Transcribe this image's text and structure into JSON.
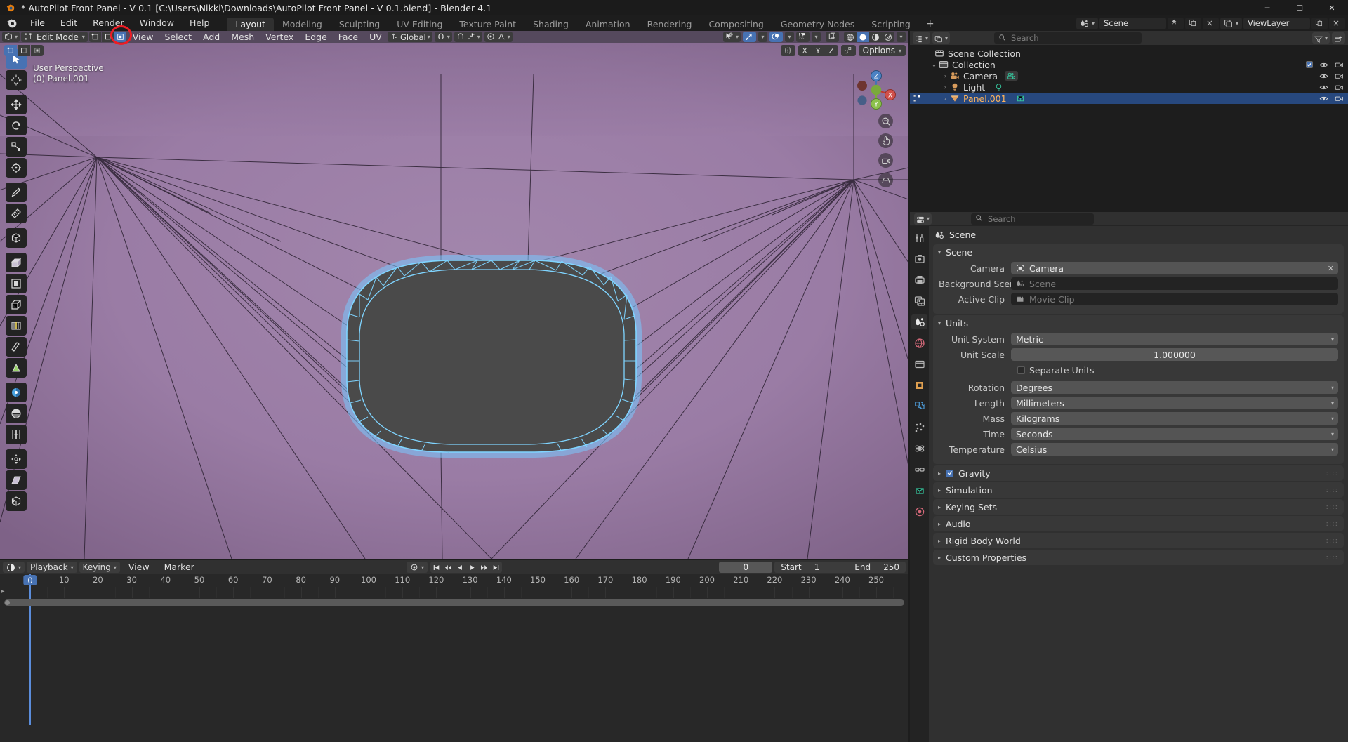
{
  "window": {
    "title": "* AutoPilot Front Panel - V 0.1 [C:\\Users\\Nikki\\Downloads\\AutoPilot Front Panel - V 0.1.blend] - Blender 4.1",
    "minimize": "─",
    "maximize": "☐",
    "close": "✕"
  },
  "topbar": {
    "menus": [
      "File",
      "Edit",
      "Render",
      "Window",
      "Help"
    ],
    "workspaces": [
      {
        "label": "Layout",
        "active": true
      },
      {
        "label": "Modeling",
        "active": false
      },
      {
        "label": "Sculpting",
        "active": false
      },
      {
        "label": "UV Editing",
        "active": false
      },
      {
        "label": "Texture Paint",
        "active": false
      },
      {
        "label": "Shading",
        "active": false
      },
      {
        "label": "Animation",
        "active": false
      },
      {
        "label": "Rendering",
        "active": false
      },
      {
        "label": "Compositing",
        "active": false
      },
      {
        "label": "Geometry Nodes",
        "active": false
      },
      {
        "label": "Scripting",
        "active": false
      }
    ],
    "add_workspace": "+",
    "scene_name": "Scene",
    "viewlayer_name": "ViewLayer"
  },
  "viewport": {
    "mode": "Edit Mode",
    "menus": [
      "View",
      "Select",
      "Add",
      "Mesh",
      "Vertex",
      "Edge",
      "Face",
      "UV"
    ],
    "transform_orientation": "Global",
    "options_label": "Options",
    "proportional_axes": [
      "X",
      "Y",
      "Z"
    ],
    "info_line1": "User Perspective",
    "info_line2": "(0) Panel.001",
    "gizmo_axes": {
      "x": "X",
      "y": "Y",
      "z": "Z"
    },
    "select_modes": [
      "vertex-select",
      "edge-select",
      "face-select"
    ],
    "tools": [
      "tweak-tool",
      "cursor-tool",
      "move-tool",
      "rotate-tool",
      "scale-tool",
      "transform-tool",
      "annotate-tool",
      "measure-tool",
      "add-cube-tool",
      "extrude-region-tool",
      "inset-faces-tool",
      "bevel-tool",
      "loop-cut-tool",
      "knife-tool",
      "poly-build-tool",
      "spin-tool",
      "smooth-tool",
      "edge-slide-tool",
      "shrink-fatten-tool",
      "shear-tool",
      "rip-region-tool"
    ],
    "shading_modes": [
      "wireframe",
      "solid",
      "material-preview",
      "rendered"
    ],
    "active_shading": "solid",
    "nav_buttons": [
      "zoom-icon",
      "pan-icon",
      "camera-icon",
      "ortho-persp-icon"
    ]
  },
  "outliner": {
    "display_mode": "view-layer",
    "filter_icon": "filter-icon",
    "search_placeholder": "Search",
    "rows": [
      {
        "name": "Scene Collection",
        "depth": 0,
        "icon": "collection-icon",
        "arrow": "",
        "selected": false,
        "datachip": null
      },
      {
        "name": "Collection",
        "depth": 1,
        "icon": "collection-icon",
        "arrow": "⌄",
        "selected": false,
        "datachip": null,
        "checkbox": true
      },
      {
        "name": "Camera",
        "depth": 2,
        "icon": "camera-data-icon",
        "arrow": "›",
        "selected": false,
        "datachip": "camera-data-icon"
      },
      {
        "name": "Light",
        "depth": 2,
        "icon": "light-icon",
        "arrow": "›",
        "selected": false,
        "datachip": "light-data-icon"
      },
      {
        "name": "Panel.001",
        "depth": 2,
        "icon": "mesh-object-icon",
        "arrow": "›",
        "selected": true,
        "datachip": "mesh-data-icon"
      }
    ]
  },
  "properties": {
    "search_placeholder": "Search",
    "breadcrumb": "Scene",
    "tabs": [
      "tool-tab",
      "render-tab",
      "output-tab",
      "viewlayer-tab",
      "scene-tab",
      "world-tab",
      "collection-tab",
      "object-tab",
      "modifier-tab",
      "particles-tab",
      "physics-tab",
      "constraints-tab",
      "data-tab",
      "material-tab"
    ],
    "active_tab": "scene-tab",
    "panels": [
      {
        "title": "Scene",
        "open": true,
        "rows": [
          {
            "label": "Camera",
            "value": "Camera",
            "type": "id",
            "icon": "camera-icon",
            "clearable": true
          },
          {
            "label": "Background Scene",
            "value": "Scene",
            "type": "empty",
            "icon": "scene-icon"
          },
          {
            "label": "Active Clip",
            "value": "Movie Clip",
            "type": "empty",
            "icon": "clip-icon"
          }
        ]
      },
      {
        "title": "Units",
        "open": true,
        "rows": [
          {
            "label": "Unit System",
            "value": "Metric",
            "type": "dropdown"
          },
          {
            "label": "Unit Scale",
            "value": "1.000000",
            "type": "number"
          },
          {
            "label": "Separate Units",
            "value": "",
            "type": "checkbox",
            "checked": false
          },
          {
            "label": "Rotation",
            "value": "Degrees",
            "type": "dropdown"
          },
          {
            "label": "Length",
            "value": "Millimeters",
            "type": "dropdown"
          },
          {
            "label": "Mass",
            "value": "Kilograms",
            "type": "dropdown"
          },
          {
            "label": "Time",
            "value": "Seconds",
            "type": "dropdown"
          },
          {
            "label": "Temperature",
            "value": "Celsius",
            "type": "dropdown"
          }
        ]
      },
      {
        "title": "Gravity",
        "open": false,
        "checkbox": true,
        "checked": true,
        "rows": []
      },
      {
        "title": "Simulation",
        "open": false,
        "rows": []
      },
      {
        "title": "Keying Sets",
        "open": false,
        "rows": []
      },
      {
        "title": "Audio",
        "open": false,
        "rows": []
      },
      {
        "title": "Rigid Body World",
        "open": false,
        "rows": []
      },
      {
        "title": "Custom Properties",
        "open": false,
        "rows": []
      }
    ]
  },
  "timeline": {
    "editor_icon": "timeline-icon",
    "menus": [
      "Playback",
      "Keying",
      "View",
      "Marker"
    ],
    "current_frame": "0",
    "start_label": "Start",
    "start_value": "1",
    "end_label": "End",
    "end_value": "250",
    "ticks": [
      0,
      10,
      20,
      30,
      40,
      50,
      60,
      70,
      80,
      90,
      100,
      110,
      120,
      130,
      140,
      150,
      160,
      170,
      180,
      190,
      200,
      210,
      220,
      230,
      240,
      250
    ],
    "playhead_frame": 0,
    "playhead_label": "0"
  },
  "colors": {
    "accent": "#4772b3",
    "viewport_bg": "#8e6f98",
    "header_bg": "#55495d",
    "panel_bg": "#303030",
    "annotation_red": "#ed1c24",
    "selected_mesh": "#6fc3f0"
  }
}
